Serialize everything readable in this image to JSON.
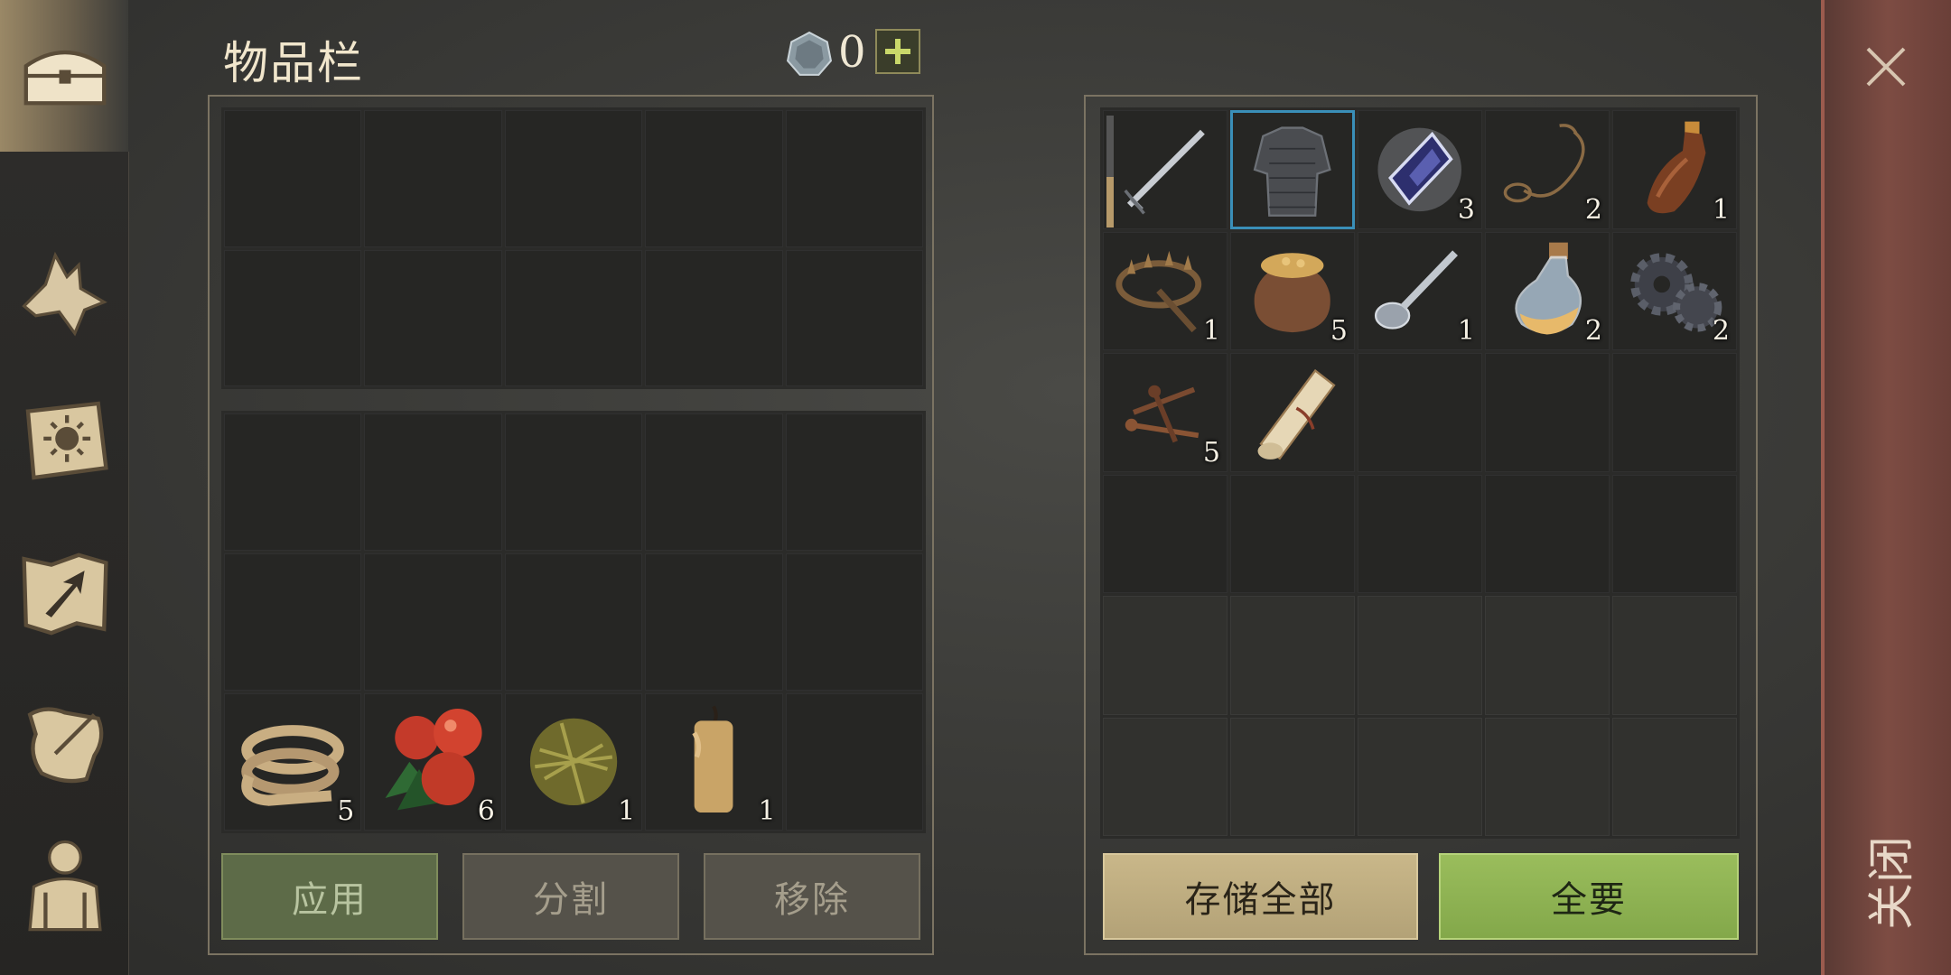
{
  "header": {
    "title": "物品栏",
    "currency_count": "0",
    "currency_icon": "silver-coin-icon"
  },
  "left_tabs": [
    {
      "name": "chest-tab",
      "icon": "chest-icon",
      "active": true
    },
    {
      "name": "wolf-tab",
      "icon": "wolf-icon",
      "active": false
    },
    {
      "name": "book-tab",
      "icon": "sun-book-icon",
      "active": false
    },
    {
      "name": "map-tab",
      "icon": "map-arrow-icon",
      "active": false
    },
    {
      "name": "scroll-tab",
      "icon": "quill-scroll-icon",
      "active": false
    },
    {
      "name": "character-tab",
      "icon": "character-icon",
      "active": false
    }
  ],
  "inventory": {
    "items": [
      {
        "name": "rope",
        "icon": "rope-icon",
        "count": "5"
      },
      {
        "name": "berries",
        "icon": "berries-icon",
        "count": "6"
      },
      {
        "name": "plant-fiber",
        "icon": "fiber-ball-icon",
        "count": "1"
      },
      {
        "name": "candle",
        "icon": "candle-icon",
        "count": "1"
      }
    ],
    "buttons": {
      "apply": "应用",
      "split": "分割",
      "remove": "移除"
    }
  },
  "storage": {
    "items": [
      {
        "name": "sword",
        "icon": "sword-icon",
        "count": "",
        "durability": 0.45
      },
      {
        "name": "chainmail",
        "icon": "chainmail-icon",
        "count": "",
        "selected": true
      },
      {
        "name": "crystal",
        "icon": "crystal-icon",
        "count": "3"
      },
      {
        "name": "lasso",
        "icon": "lasso-icon",
        "count": "2"
      },
      {
        "name": "bottle",
        "icon": "bottle-icon",
        "count": "1"
      },
      {
        "name": "bear-trap",
        "icon": "bear-trap-icon",
        "count": "1"
      },
      {
        "name": "grain-sack",
        "icon": "sack-icon",
        "count": "5"
      },
      {
        "name": "spoon",
        "icon": "spoon-icon",
        "count": "1"
      },
      {
        "name": "potion",
        "icon": "potion-icon",
        "count": "2"
      },
      {
        "name": "gears",
        "icon": "gear-icon",
        "count": "2"
      },
      {
        "name": "nails",
        "icon": "nails-icon",
        "count": "5"
      },
      {
        "name": "scroll",
        "icon": "scroll-icon",
        "count": ""
      }
    ],
    "buttons": {
      "store_all": "存储全部",
      "take_all": "全要"
    }
  },
  "close": {
    "label": "关闭"
  },
  "colors": {
    "selected_border": "#3a8fb8",
    "take_all": "#8fb352",
    "store_all": "#c2b083",
    "close_strip": "#7d4c43"
  }
}
